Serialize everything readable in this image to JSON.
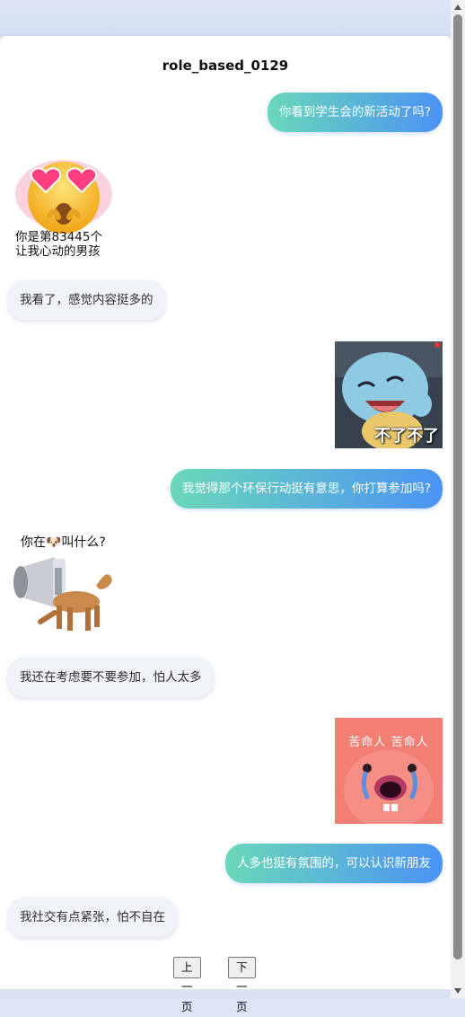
{
  "title": "role_based_0129",
  "messages": [
    {
      "side": "right",
      "text": "你看到学生会的新活动了吗?"
    },
    {
      "side": "left",
      "sticker": "heart-eyes-face",
      "caption": "你是第83445个\n让我心动的男孩"
    },
    {
      "side": "left",
      "text": "我看了，感觉内容挺多的"
    },
    {
      "side": "right",
      "sticker": "squirtle-laughing",
      "caption": "不了不了"
    },
    {
      "side": "right",
      "text": "我觉得那个环保行动挺有意思，你打算参加吗?"
    },
    {
      "side": "left",
      "sticker": "dog-megaphone",
      "caption": "你在🐶叫什么?"
    },
    {
      "side": "left",
      "text": "我还在考虑要不要参加，怕人太多"
    },
    {
      "side": "right",
      "sticker": "crying-pink-creature",
      "caption": "苦命人 苦命人"
    },
    {
      "side": "right",
      "text": "人多也挺有氛围的，可以认识新朋友"
    },
    {
      "side": "left",
      "text": "我社交有点紧张，怕不自在"
    }
  ],
  "pagination": {
    "prev": "上一页",
    "next": "下一页"
  }
}
